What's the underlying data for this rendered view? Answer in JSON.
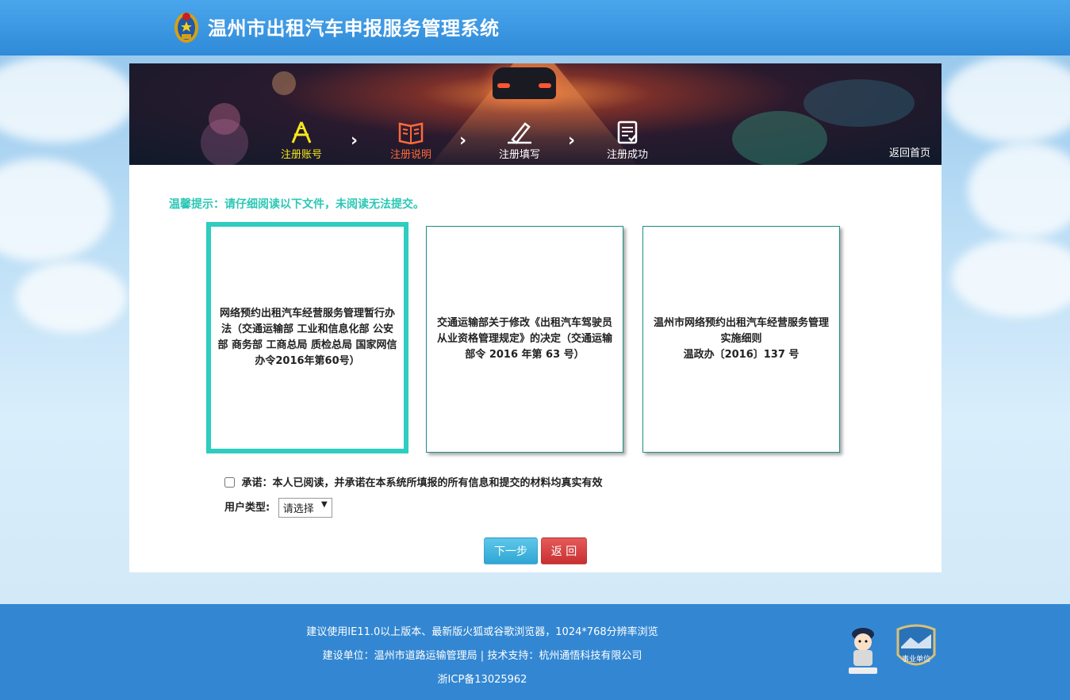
{
  "header": {
    "title": "温州市出租汽车申报服务管理系统",
    "logo_icon": "police-emblem-icon"
  },
  "steps": [
    {
      "label": "注册账号",
      "color": "#f5e61c",
      "icon": "compass-icon"
    },
    {
      "label": "注册说明",
      "color": "#ff6a3a",
      "icon": "book-icon"
    },
    {
      "label": "注册填写",
      "color": "#ffffff",
      "icon": "pen-icon"
    },
    {
      "label": "注册成功",
      "color": "#ffffff",
      "icon": "checklist-icon"
    }
  ],
  "home_link": "返回首页",
  "tip": "温馨提示：请仔细阅读以下文件，未阅读无法提交。",
  "documents": [
    {
      "text": "网络预约出租汽车经营服务管理暂行办法（交通运输部 工业和信息化部 公安部 商务部 工商总局 质检总局 国家网信办令2016年第60号）",
      "active": true
    },
    {
      "text": "交通运输部关于修改《出租汽车驾驶员从业资格管理规定》的决定（交通运输部令 2016 年第 63 号）",
      "active": false
    },
    {
      "text": "温州市网络预约出租汽车经营服务管理实施细则\n温政办〔2016〕137 号",
      "active": false
    }
  ],
  "promise": {
    "label": "承诺：本人已阅读，并承诺在本系统所填报的所有信息和提交的材料均真实有效",
    "checked": false
  },
  "user_type": {
    "label": "用户类型:",
    "selected": "请选择"
  },
  "buttons": {
    "next": "下一步",
    "back": "返 回"
  },
  "footer": {
    "line1": "建议使用IE11.0以上版本、最新版火狐或谷歌浏览器，1024*768分辨率浏览",
    "line2": "建设单位：温州市道路运输管理局 | 技术支持：杭州通悟科技有限公司",
    "line3": "浙ICP备13025962",
    "badge_text": "事业单位"
  },
  "colors": {
    "accent": "#2bc7b5",
    "header_blue": "#2f8ad8",
    "footer_blue": "#3387d2",
    "next_btn": "#2fa7d4",
    "back_btn": "#c83030"
  }
}
